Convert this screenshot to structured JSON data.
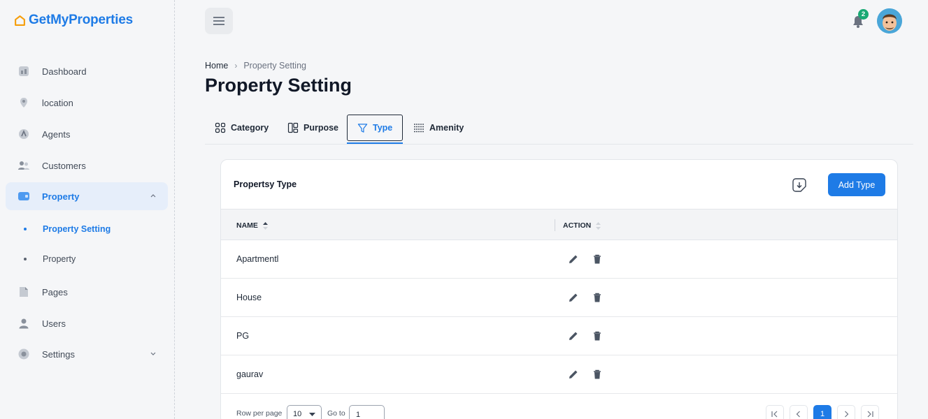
{
  "brand": {
    "name": "GetMyProperties",
    "accent": "#1e7be6",
    "logo_color": "#f59e0b"
  },
  "sidebar": {
    "items": [
      {
        "label": "Dashboard",
        "icon": "dashboard-icon"
      },
      {
        "label": "location",
        "icon": "location-pin-icon"
      },
      {
        "label": "Agents",
        "icon": "agents-icon"
      },
      {
        "label": "Customers",
        "icon": "customers-icon"
      },
      {
        "label": "Property",
        "icon": "property-icon",
        "expanded": true,
        "active": true
      },
      {
        "label": "Pages",
        "icon": "pages-icon"
      },
      {
        "label": "Users",
        "icon": "user-icon"
      },
      {
        "label": "Settings",
        "icon": "gear-icon",
        "expandable": true
      }
    ],
    "subitems": [
      {
        "label": "Property Setting",
        "active": true
      },
      {
        "label": "Property"
      }
    ]
  },
  "topbar": {
    "notification_count": "2",
    "menu_icon": "hamburger-icon",
    "bell_icon": "bell-icon"
  },
  "breadcrumb": {
    "home": "Home",
    "separator": "›",
    "current": "Property Setting"
  },
  "page": {
    "title": "Property Setting"
  },
  "tabs": [
    {
      "label": "Category",
      "icon": "grid-icon"
    },
    {
      "label": "Purpose",
      "icon": "layout-icon"
    },
    {
      "label": "Type",
      "icon": "filter-icon",
      "active": true
    },
    {
      "label": "Amenity",
      "icon": "dots-grid-icon"
    }
  ],
  "card": {
    "title": "Propertsy Type",
    "add_button": "Add Type",
    "export_icon": "download-icon"
  },
  "table": {
    "columns": [
      "NAME",
      "ACTION"
    ],
    "rows": [
      {
        "name": "Apartmentl"
      },
      {
        "name": "House"
      },
      {
        "name": "PG"
      },
      {
        "name": "gaurav"
      }
    ]
  },
  "pagination": {
    "rows_per_page_label": "Row per page",
    "rows_per_page_value": "10",
    "goto_label": "Go to",
    "goto_value": "1",
    "current_page": "1"
  }
}
